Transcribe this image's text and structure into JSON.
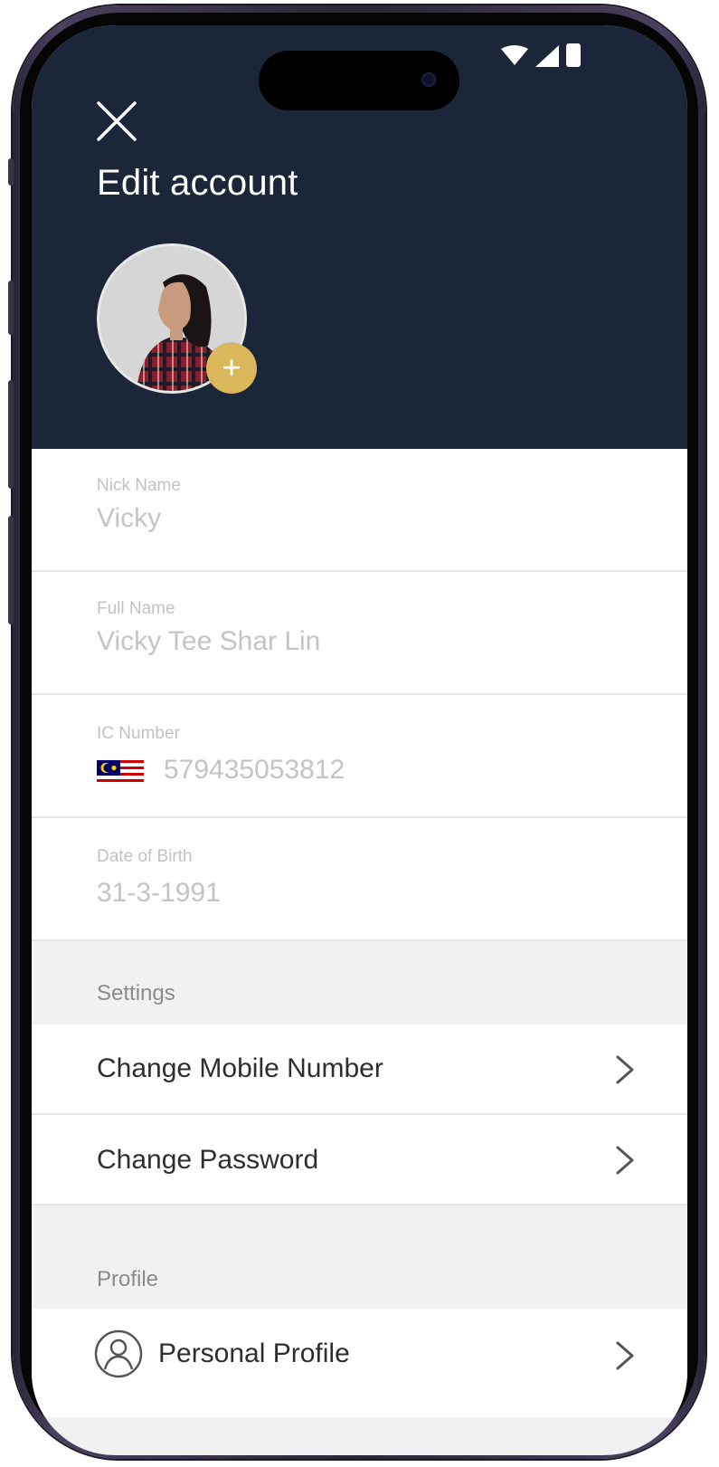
{
  "header": {
    "title": "Edit account"
  },
  "fields": {
    "nick_name": {
      "label": "Nick Name",
      "value": "Vicky"
    },
    "full_name": {
      "label": "Full Name",
      "value": "Vicky Tee Shar Lin"
    },
    "ic_number": {
      "label": "IC Number",
      "value": "579435053812"
    },
    "dob": {
      "label": "Date of Birth",
      "value": "31-3-1991"
    }
  },
  "settings": {
    "label": "Settings",
    "items": [
      {
        "label": "Change Mobile Number"
      },
      {
        "label": "Change Password"
      }
    ]
  },
  "profile": {
    "label": "Profile",
    "items": [
      {
        "label": "Personal Profile"
      }
    ]
  },
  "icons": [
    "close-icon",
    "add-icon",
    "wifi-icon",
    "signal-icon",
    "battery-icon",
    "flag-malaysia-icon",
    "chevron-right-icon",
    "person-icon"
  ],
  "colors": {
    "header_bg": "#1b2638",
    "accent": "#d9b75a"
  }
}
